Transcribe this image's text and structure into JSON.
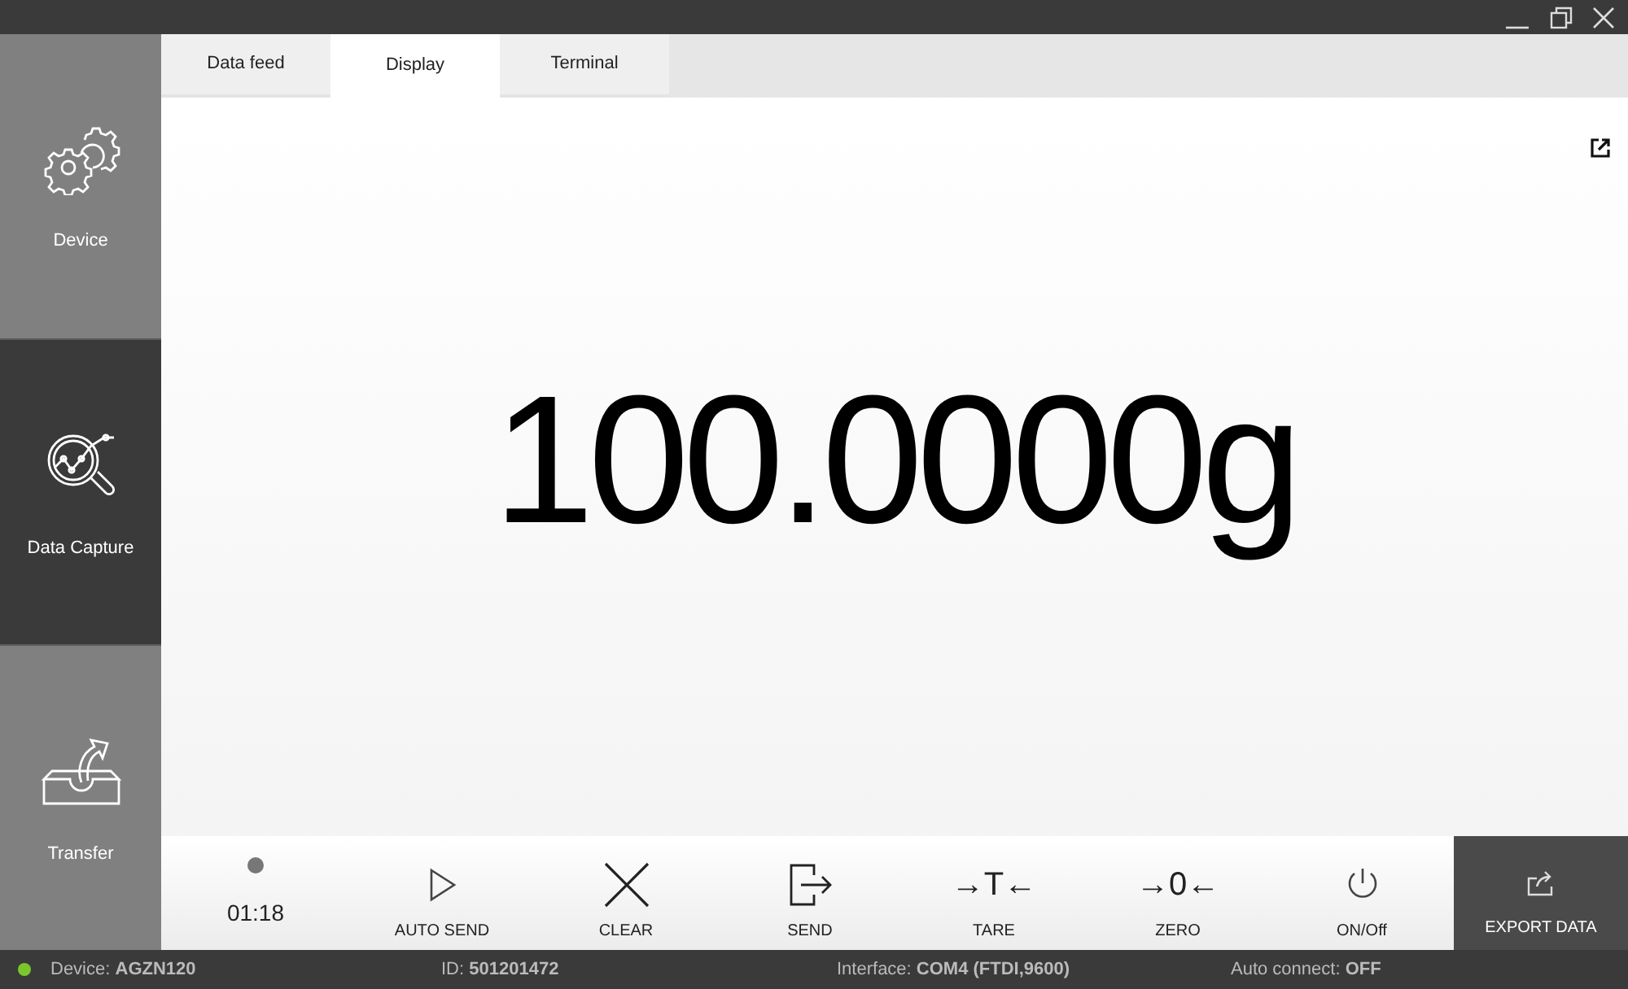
{
  "sidebar": {
    "items": [
      {
        "label": "Device",
        "kind": "gear",
        "selected": false
      },
      {
        "label": "Data Capture",
        "kind": "capture",
        "selected": true
      },
      {
        "label": "Transfer",
        "kind": "transfer",
        "selected": false
      }
    ]
  },
  "tabs": [
    {
      "label": "Data feed",
      "selected": false
    },
    {
      "label": "Display",
      "selected": true
    },
    {
      "label": "Terminal",
      "selected": false
    }
  ],
  "display": {
    "reading": "100.0000g"
  },
  "toolbar": {
    "timer": {
      "time": "01:18",
      "recording": true
    },
    "buttons": [
      {
        "label": "AUTO SEND",
        "kind": "play"
      },
      {
        "label": "CLEAR",
        "kind": "clear"
      },
      {
        "label": "SEND",
        "kind": "send"
      },
      {
        "label": "TARE",
        "kind": "glyph",
        "glyph": "→T←"
      },
      {
        "label": "ZERO",
        "kind": "glyph",
        "glyph": "→0←"
      },
      {
        "label": "ON/Off",
        "kind": "power"
      }
    ],
    "export": {
      "label": "EXPORT DATA"
    }
  },
  "status_bar": {
    "connected": true,
    "items": [
      "Device: **AGZN120**",
      "ID: **501201472**",
      "Interface: **COM4 (FTDI,9600)**",
      "Auto connect: **OFF**"
    ]
  }
}
